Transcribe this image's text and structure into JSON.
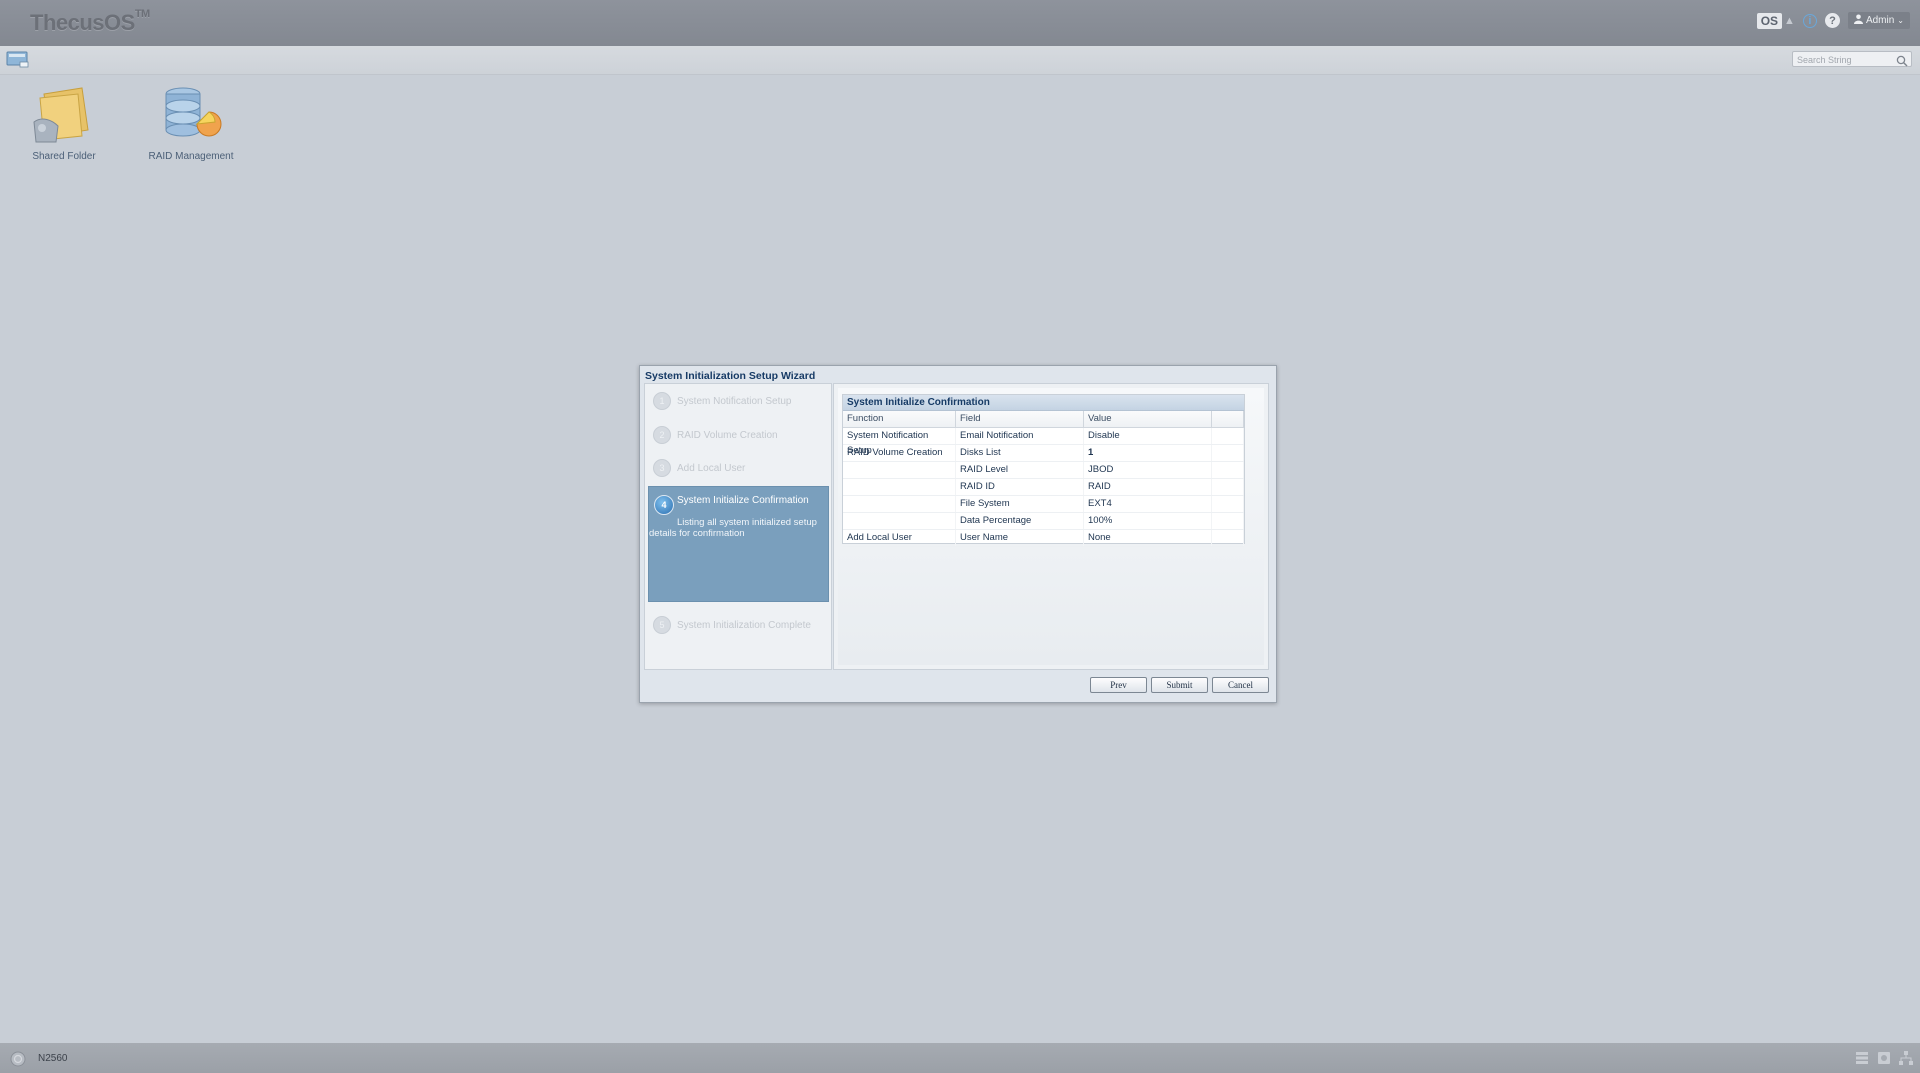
{
  "topbar": {
    "logo": "ThecusOS",
    "logo_sup": "TM",
    "os_badge": "OS",
    "user": "Admin",
    "search_placeholder": "Search String"
  },
  "desktop": {
    "icons": [
      {
        "label": "Shared Folder"
      },
      {
        "label": "RAID Management"
      }
    ]
  },
  "wizard": {
    "title": "System Initialization Setup Wizard",
    "steps": [
      {
        "num": "1",
        "label": "System Notification Setup"
      },
      {
        "num": "2",
        "label": "RAID Volume Creation"
      },
      {
        "num": "3",
        "label": "Add Local User"
      },
      {
        "num": "4",
        "label": "System Initialize Confirmation",
        "desc": "Listing all system initialized setup details for confirmation"
      },
      {
        "num": "5",
        "label": "System Initialization Complete"
      }
    ],
    "grid": {
      "title": "System Initialize Confirmation",
      "columns": [
        "Function",
        "Field",
        "Value"
      ],
      "rows": [
        {
          "function": "System Notification Setup",
          "field": "Email Notification",
          "value": "Disable"
        },
        {
          "function": "RAID Volume Creation",
          "field": "Disks List",
          "value": "1"
        },
        {
          "function": "",
          "field": "RAID Level",
          "value": "JBOD"
        },
        {
          "function": "",
          "field": "RAID ID",
          "value": "RAID"
        },
        {
          "function": "",
          "field": "File System",
          "value": "EXT4"
        },
        {
          "function": "",
          "field": "Data Percentage",
          "value": "100%"
        },
        {
          "function": "Add Local User",
          "field": "User Name",
          "value": "None"
        }
      ]
    },
    "buttons": {
      "prev": "Prev",
      "submit": "Submit",
      "cancel": "Cancel"
    }
  },
  "bottombar": {
    "device": "N2560"
  }
}
